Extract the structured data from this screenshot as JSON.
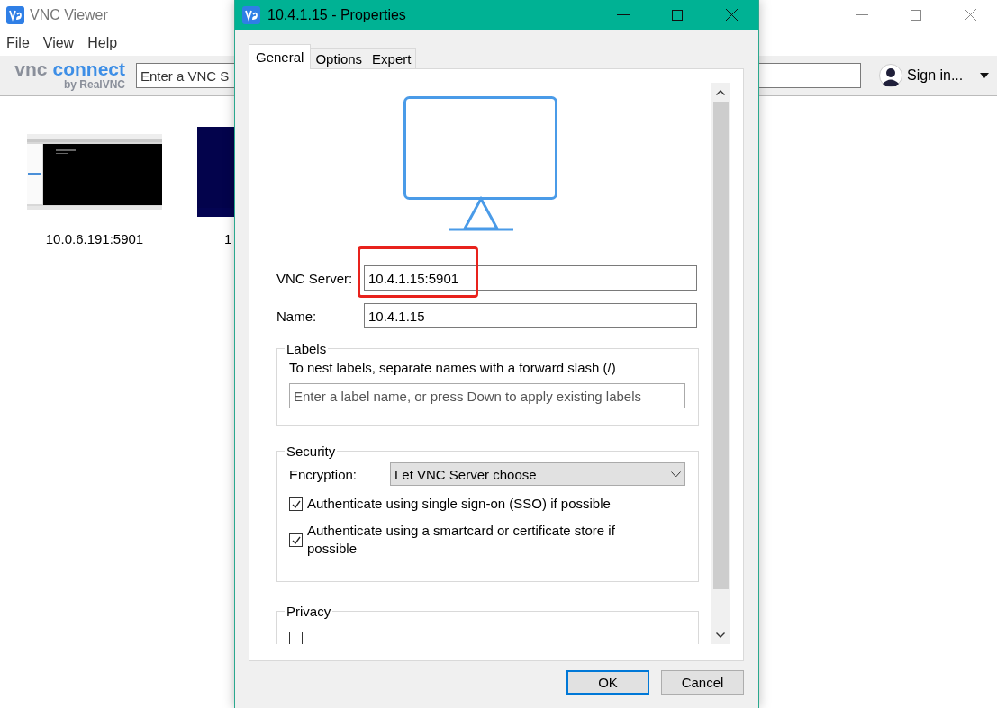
{
  "main_window": {
    "title": "VNC Viewer",
    "menu": [
      "File",
      "View",
      "Help"
    ],
    "logo": {
      "wordmark_left": "vnc",
      "wordmark_right": "connect",
      "byline": "by RealVNC"
    },
    "search": {
      "placeholder": "Enter a VNC S"
    },
    "account": {
      "label": "Sign in..."
    },
    "connections": [
      {
        "label": "10.0.6.191:5901",
        "kind": "screenshot"
      },
      {
        "label": "1",
        "kind": "blank"
      }
    ]
  },
  "dialog": {
    "title": "10.4.1.15 - Properties",
    "tabs": [
      {
        "label": "General",
        "selected": true
      },
      {
        "label": "Options",
        "selected": false
      },
      {
        "label": "Expert",
        "selected": false
      }
    ],
    "fields": [
      {
        "label": "VNC Server:",
        "value": "10.4.1.15:5901",
        "highlighted": true
      },
      {
        "label": "Name:",
        "value": "10.4.1.15",
        "highlighted": false
      }
    ],
    "labels_group": {
      "title": "Labels",
      "hint": "To nest labels, separate names with a forward slash (/)",
      "placeholder": "Enter a label name, or press Down to apply existing labels"
    },
    "security_group": {
      "title": "Security",
      "encryption_label": "Encryption:",
      "encryption_value": "Let VNC Server choose",
      "options": [
        {
          "label": "Authenticate using single sign-on (SSO) if possible",
          "checked": true
        },
        {
          "label": "Authenticate using a smartcard or certificate store if possible",
          "checked": true
        }
      ]
    },
    "privacy_group": {
      "title": "Privacy",
      "options": [
        {
          "checked": false
        }
      ]
    },
    "buttons": [
      {
        "label": "OK",
        "default": true
      },
      {
        "label": "Cancel",
        "default": false
      }
    ]
  }
}
